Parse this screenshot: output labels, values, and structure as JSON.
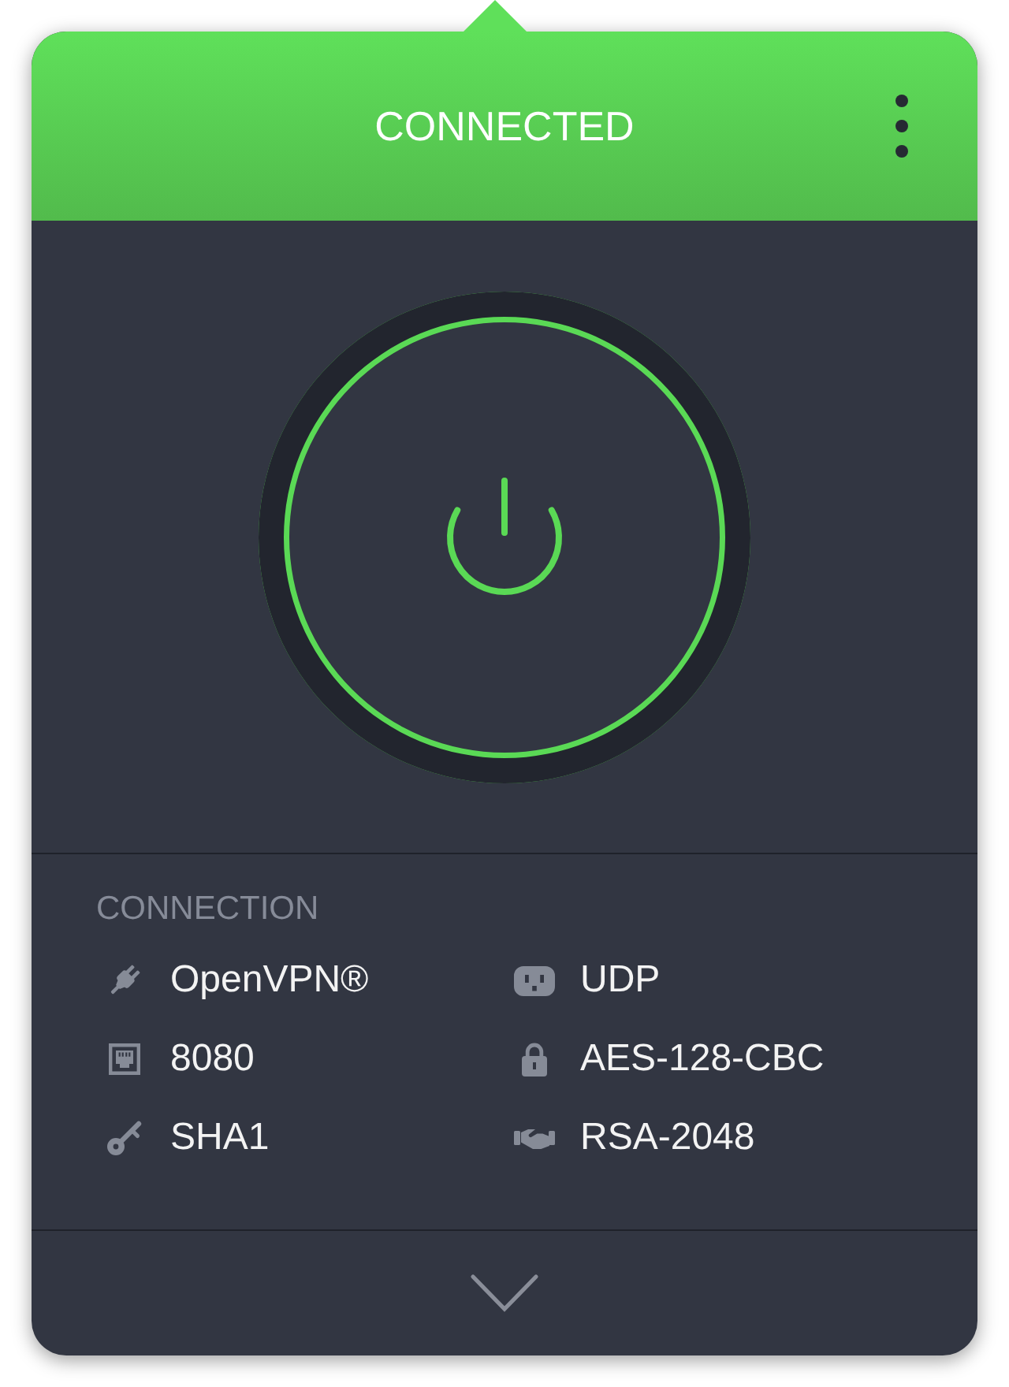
{
  "connected": true,
  "header": {
    "title": "CONNECTED"
  },
  "connection": {
    "heading": "CONNECTION",
    "items": [
      {
        "kind": "protocol",
        "value": "OpenVPN®"
      },
      {
        "kind": "transport",
        "value": "UDP"
      },
      {
        "kind": "port",
        "value": "8080"
      },
      {
        "kind": "encryption",
        "value": "AES-128-CBC"
      },
      {
        "kind": "authentication",
        "value": "SHA1"
      },
      {
        "kind": "handshake",
        "value": "RSA-2048"
      }
    ]
  }
}
